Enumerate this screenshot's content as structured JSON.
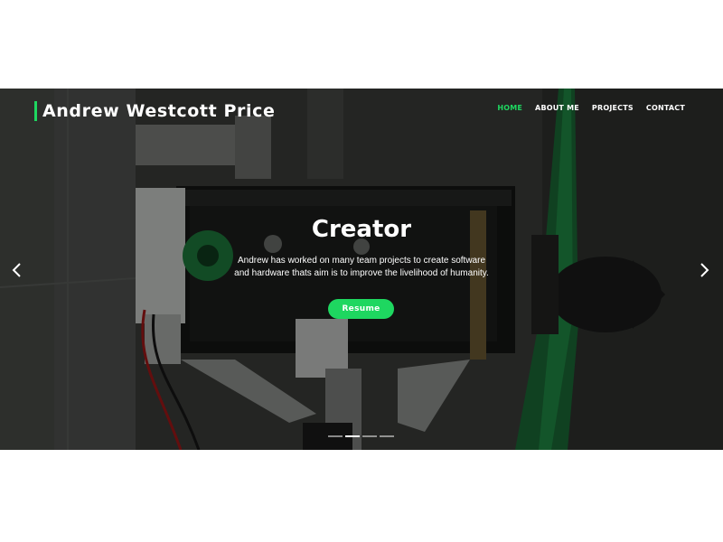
{
  "header": {
    "brand_name": "Andrew Westcott Price",
    "accent_color": "#1ed760",
    "nav": [
      {
        "label": "HOME",
        "active": true
      },
      {
        "label": "ABOUT ME",
        "active": false
      },
      {
        "label": "PROJECTS",
        "active": false
      },
      {
        "label": "CONTACT",
        "active": false
      }
    ]
  },
  "hero": {
    "title": "Creator",
    "description": "Andrew has worked on many team projects to create software and hardware thats aim is to improve the livelihood of humanity.",
    "button_label": "Resume",
    "prev_icon": "chevron-left-icon",
    "next_icon": "chevron-right-icon",
    "slide_count": 4,
    "active_slide": 2
  }
}
